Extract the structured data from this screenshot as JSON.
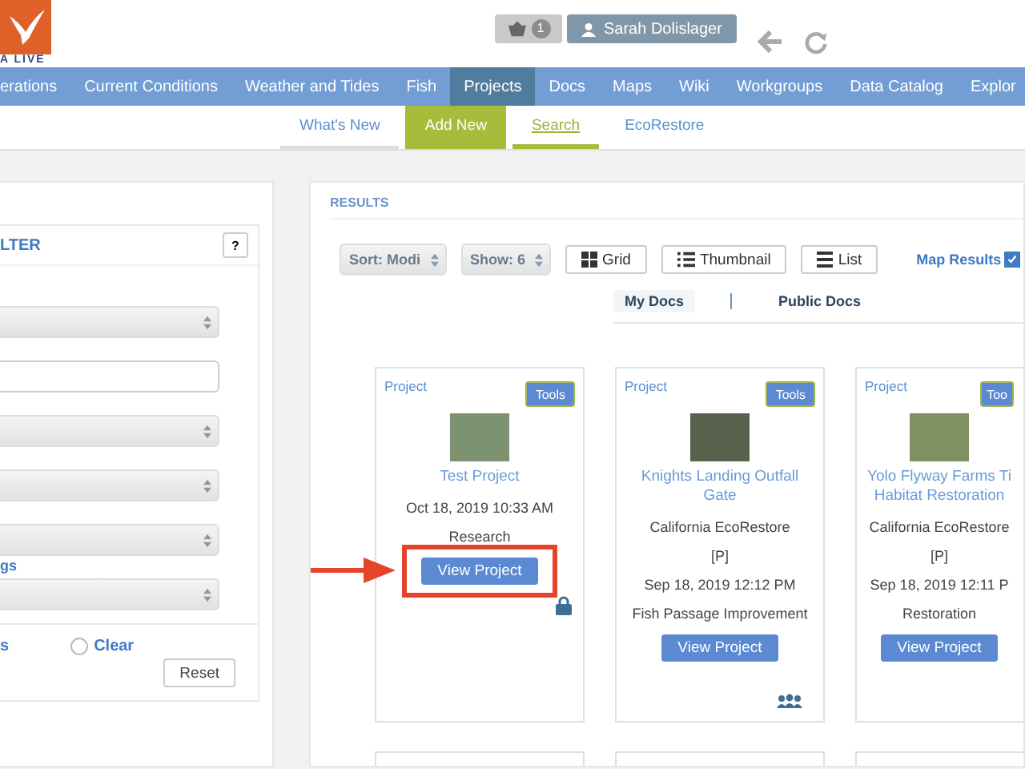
{
  "header": {
    "logo_text": "A LIVE",
    "cart_count": "1",
    "user_name": "Sarah Dolislager"
  },
  "nav": [
    {
      "label": "erations",
      "selected": false
    },
    {
      "label": "Current Conditions",
      "selected": false
    },
    {
      "label": "Weather and Tides",
      "selected": false
    },
    {
      "label": "Fish",
      "selected": false
    },
    {
      "label": "Projects",
      "selected": true
    },
    {
      "label": "Docs",
      "selected": false
    },
    {
      "label": "Maps",
      "selected": false
    },
    {
      "label": "Wiki",
      "selected": false
    },
    {
      "label": "Workgroups",
      "selected": false
    },
    {
      "label": "Data Catalog",
      "selected": false
    },
    {
      "label": "Explor",
      "selected": false
    }
  ],
  "subnav": [
    {
      "label": "What's New",
      "kind": "tab",
      "selected": false
    },
    {
      "label": "Add New",
      "kind": "action",
      "selected": false
    },
    {
      "label": "Search",
      "kind": "tab",
      "selected": true
    },
    {
      "label": "EcoRestore",
      "kind": "tab",
      "selected": false
    }
  ],
  "filter": {
    "title": "LTER",
    "help": "?",
    "fields": [
      {
        "kind": "select"
      },
      {
        "kind": "input"
      },
      {
        "kind": "select"
      },
      {
        "kind": "select"
      },
      {
        "kind": "select"
      },
      {
        "kind": "link",
        "label": "gs"
      },
      {
        "kind": "select"
      }
    ],
    "link": "s",
    "clear": {
      "label": "Clear",
      "checked": false
    },
    "reset": "Reset"
  },
  "results": {
    "title": "RESULTS",
    "sort": "Sort: Modi",
    "show": "Show: 6",
    "views": [
      {
        "kind": "grid",
        "label": "Grid"
      },
      {
        "kind": "thumbnail",
        "label": "Thumbnail"
      },
      {
        "kind": "list",
        "label": "List"
      }
    ],
    "map_results": {
      "label": "Map Results",
      "checked": true
    },
    "tabs": [
      {
        "label": "My Docs",
        "selected": true
      },
      {
        "label": "Public Docs",
        "selected": false
      }
    ],
    "cards": [
      {
        "type": "Project",
        "tools": "Tools",
        "title": "Test Project",
        "lines": [
          "Oct 18, 2019 10:33 AM",
          "Research"
        ],
        "button": "View Project",
        "locked": true,
        "shared": false,
        "highlighted": true
      },
      {
        "type": "Project",
        "tools": "Tools",
        "title": "Knights Landing Outfall Gate",
        "lines": [
          "California EcoRestore",
          "[P]",
          "Sep 18, 2019 12:12 PM",
          "Fish Passage Improvement"
        ],
        "button": "View Project",
        "locked": false,
        "shared": true,
        "highlighted": false
      },
      {
        "type": "Project",
        "tools": "Too",
        "title": "Yolo Flyway Farms Ti Habitat Restoration",
        "lines": [
          "California EcoRestore",
          "[P]",
          "Sep 18, 2019 12:11 P",
          "Restoration"
        ],
        "button": "View Project",
        "locked": false,
        "shared": false,
        "highlighted": false
      }
    ]
  }
}
